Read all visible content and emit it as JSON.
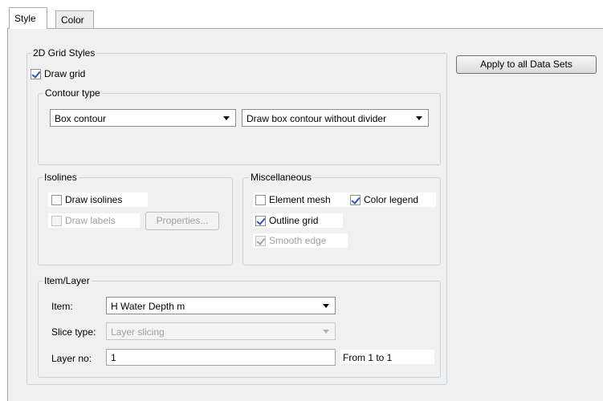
{
  "tabs": [
    {
      "label": "Style"
    },
    {
      "label": "Color"
    }
  ],
  "grid_styles": {
    "title": "2D Grid Styles",
    "draw_grid": {
      "label": "Draw grid",
      "checked": true
    }
  },
  "contour": {
    "title": "Contour type",
    "type_value": "Box contour",
    "divider_value": "Draw box contour without divider"
  },
  "isolines": {
    "title": "Isolines",
    "draw_isolines": {
      "label": "Draw isolines",
      "checked": false
    },
    "draw_labels": {
      "label": "Draw labels",
      "checked": false,
      "disabled": true
    },
    "properties_label": "Properties..."
  },
  "misc": {
    "title": "Miscellaneous",
    "element_mesh": {
      "label": "Element mesh",
      "checked": false
    },
    "color_legend": {
      "label": "Color legend",
      "checked": true
    },
    "outline_grid": {
      "label": "Outline grid",
      "checked": true
    },
    "smooth_edge": {
      "label": "Smooth edge",
      "checked": true,
      "disabled": true
    }
  },
  "item_layer": {
    "title": "Item/Layer",
    "item_label": "Item:",
    "item_value": "H Water Depth m",
    "slice_label": "Slice type:",
    "slice_value": "Layer slicing",
    "layer_label": "Layer no:",
    "layer_value": "1",
    "range_text": "From 1 to 1"
  },
  "apply_all_label": "Apply to all Data Sets"
}
